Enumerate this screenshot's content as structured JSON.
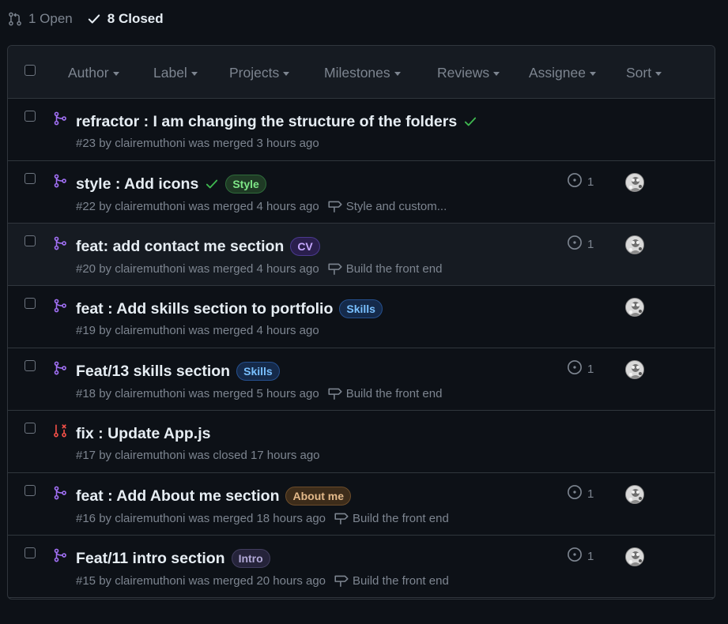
{
  "states": {
    "open_label": "1 Open",
    "closed_label": "8 Closed"
  },
  "filters": {
    "author": "Author",
    "label": "Label",
    "projects": "Projects",
    "milestones": "Milestones",
    "reviews": "Reviews",
    "assignee": "Assignee",
    "sort": "Sort"
  },
  "colors": {
    "background": "#0d1117",
    "merged_purple": "#a371f7",
    "closed_red": "#f85149",
    "success_green": "#3fb950"
  },
  "pull_requests": [
    {
      "title": "refractor : I am changing the structure of the folders",
      "status": "merged",
      "checks_passed": true,
      "label": null,
      "meta": "#23 by clairemuthoni was merged 3 hours ago",
      "milestone": null,
      "issue_count": null,
      "avatar": false
    },
    {
      "title": "style : Add icons",
      "status": "merged",
      "checks_passed": true,
      "label": {
        "name": "Style",
        "text_color": "#7ee787",
        "bg": "#1f3a25",
        "border": "#2e6b3a"
      },
      "meta": "#22 by clairemuthoni was merged 4 hours ago",
      "milestone": "Style and custom...",
      "issue_count": "1",
      "avatar": true
    },
    {
      "title": "feat: add contact me section",
      "status": "merged",
      "checks_passed": false,
      "label": {
        "name": "CV",
        "text_color": "#c6a9ff",
        "bg": "#2a1f4d",
        "border": "#4b3a8f"
      },
      "meta": "#20 by clairemuthoni was merged 4 hours ago",
      "milestone": "Build the front end",
      "issue_count": "1",
      "avatar": true
    },
    {
      "title": "feat : Add skills section to portfolio",
      "status": "merged",
      "checks_passed": false,
      "label": {
        "name": "Skills",
        "text_color": "#79c0ff",
        "bg": "#152a4a",
        "border": "#25508f"
      },
      "meta": "#19 by clairemuthoni was merged 4 hours ago",
      "milestone": null,
      "issue_count": null,
      "avatar": true
    },
    {
      "title": "Feat/13 skills section",
      "status": "merged",
      "checks_passed": false,
      "label": {
        "name": "Skills",
        "text_color": "#79c0ff",
        "bg": "#152a4a",
        "border": "#25508f"
      },
      "meta": "#18 by clairemuthoni was merged 5 hours ago",
      "milestone": "Build the front end",
      "issue_count": "1",
      "avatar": true
    },
    {
      "title": "fix : Update App.js",
      "status": "closed",
      "checks_passed": false,
      "label": null,
      "meta": "#17 by clairemuthoni was closed 17 hours ago",
      "milestone": null,
      "issue_count": null,
      "avatar": false
    },
    {
      "title": "feat : Add About me section",
      "status": "merged",
      "checks_passed": false,
      "label": {
        "name": "About me",
        "text_color": "#e3b98a",
        "bg": "#3d2c1a",
        "border": "#6b4c2a"
      },
      "meta": "#16 by clairemuthoni was merged 18 hours ago",
      "milestone": "Build the front end",
      "issue_count": "1",
      "avatar": true
    },
    {
      "title": "Feat/11 intro section",
      "status": "merged",
      "checks_passed": false,
      "label": {
        "name": "Intro",
        "text_color": "#b1a8d6",
        "bg": "#25233a",
        "border": "#413d5e"
      },
      "meta": "#15 by clairemuthoni was merged 20 hours ago",
      "milestone": "Build the front end",
      "issue_count": "1",
      "avatar": true
    }
  ]
}
